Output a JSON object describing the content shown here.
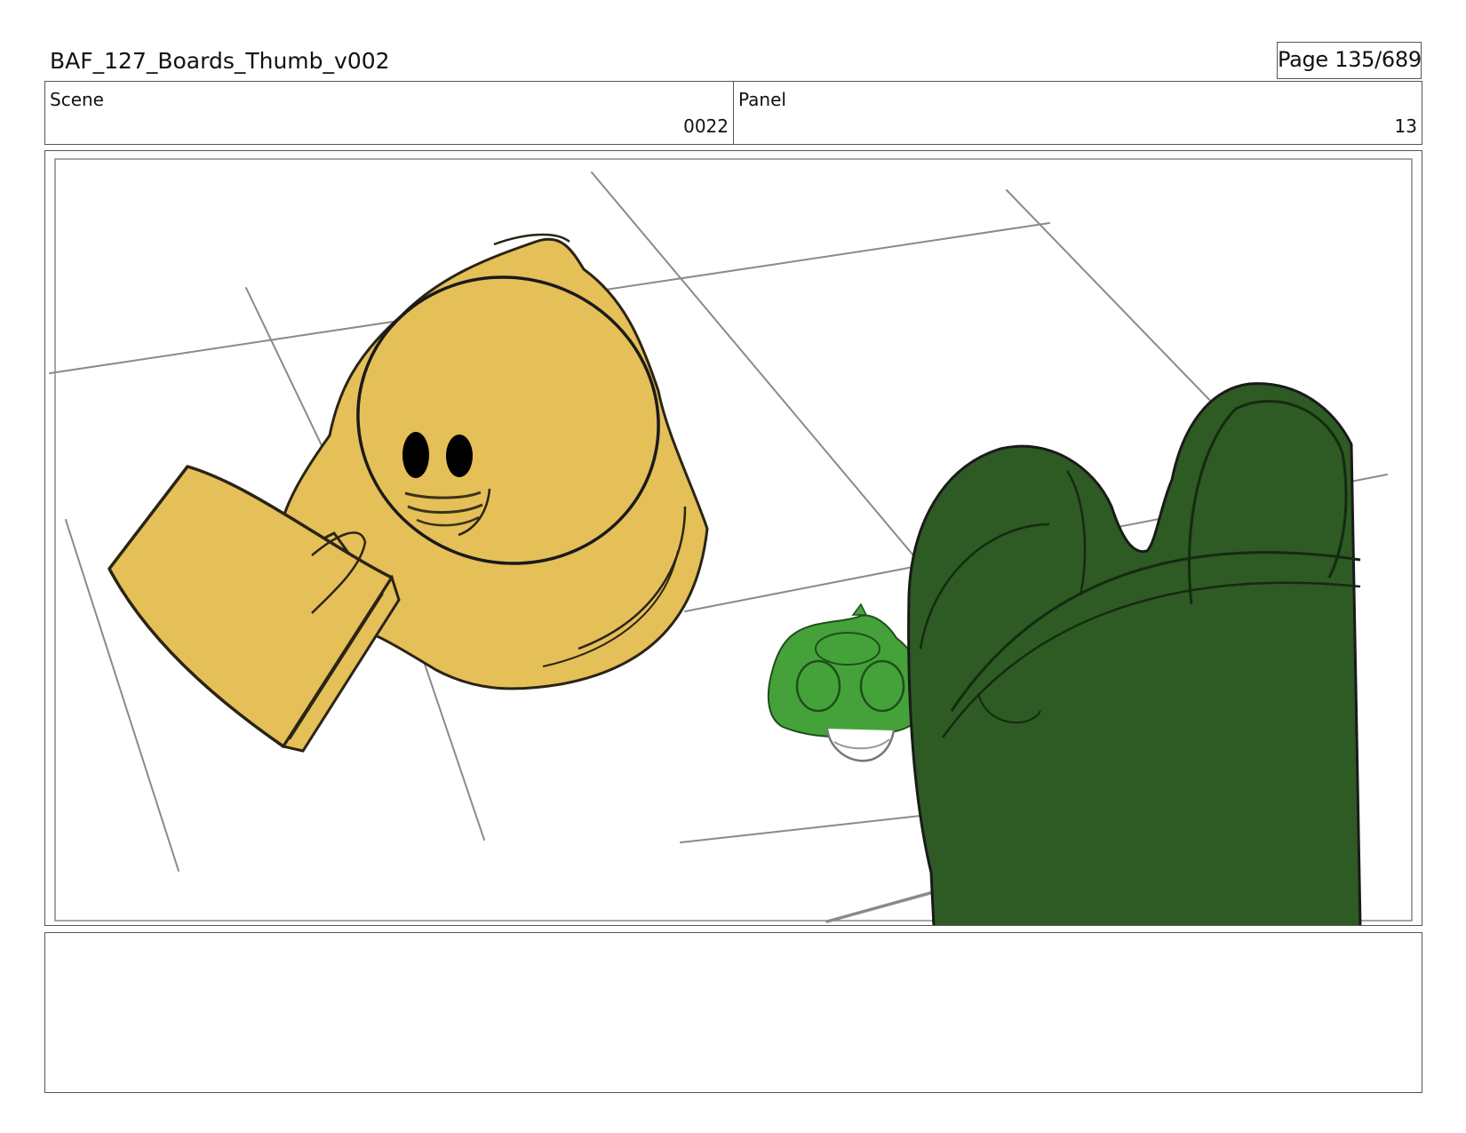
{
  "header": {
    "title": "BAF_127_Boards_Thumb_v002",
    "page": "Page 135/689"
  },
  "info": {
    "scene_label": "Scene",
    "scene_value": "0022",
    "panel_label": "Panel",
    "panel_value": "13"
  },
  "colors": {
    "yellow_character": "#e5bf58",
    "large_green_character": "#2e5a24",
    "small_green_character": "#45a23b",
    "line_art": "#1a1a1a",
    "floor_lines": "#888888",
    "frame_border": "#555555"
  },
  "notes": {
    "text": ""
  }
}
